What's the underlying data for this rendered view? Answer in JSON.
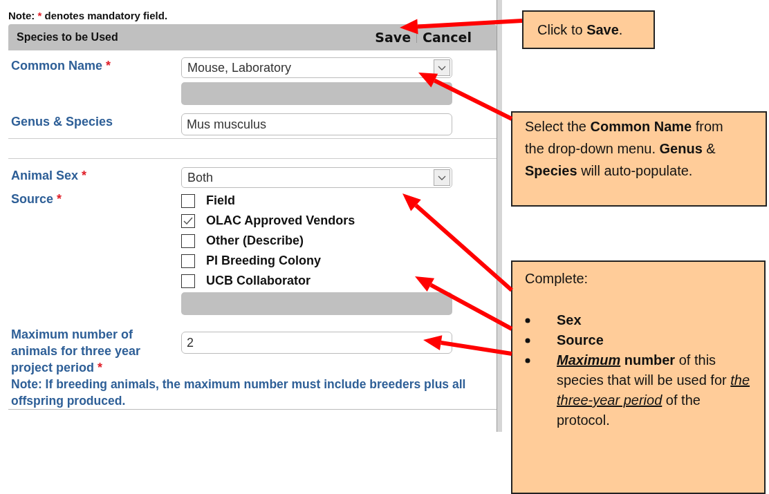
{
  "note": {
    "prefix": "Note:",
    "mark": "*",
    "suffix": "denotes mandatory field."
  },
  "section": {
    "title": "Species to be Used",
    "actions": [
      "Save",
      "Cancel"
    ]
  },
  "fields": [
    {
      "kind": "select",
      "label": "Common Name",
      "mark": "*",
      "value": "Mouse, Laboratory",
      "extra_bar": true
    },
    {
      "kind": "text",
      "label": "Genus & Species",
      "value": "Mus musculus",
      "divider_after": true
    },
    {
      "kind": "select",
      "label": "Animal Sex",
      "mark": "*",
      "value": "Both"
    },
    {
      "kind": "checks",
      "label": "Source",
      "mark": "*",
      "options": [
        {
          "label": "Field",
          "checked": false
        },
        {
          "label": "OLAC Approved Vendors",
          "checked": true
        },
        {
          "label": "Other (Describe)",
          "checked": false
        },
        {
          "label": "PI Breeding Colony",
          "checked": false
        },
        {
          "label": "UCB Collaborator",
          "checked": false
        }
      ],
      "extra_bar": true
    },
    {
      "kind": "text",
      "label": "Maximum number of animals for three year project period",
      "mark": "*",
      "value": "2"
    }
  ],
  "footnote": "Note: If breeding animals, the maximum number must include breeders plus all offspring produced.",
  "callouts": [
    {
      "kind": "simple",
      "text": "Click to **Save**."
    },
    {
      "kind": "simple",
      "text": "Select the **Common Name** from the drop-down menu. **Genus** & **Species** will auto-populate."
    },
    {
      "kind": "list",
      "intro": "Complete:",
      "bullets": [
        [
          {
            "text": "Sex",
            "bold": true
          }
        ],
        [
          {
            "text": "Source",
            "bold": true
          }
        ],
        [
          {
            "text": "Maximum",
            "bold": true,
            "italic": true,
            "underline": true
          },
          {
            "text": " number",
            "bold": true
          },
          {
            "text": " of this species that will be used for "
          },
          {
            "text": "the three-year period",
            "italic": true,
            "underline": true
          },
          {
            "text": " of the protocol."
          }
        ]
      ]
    }
  ]
}
